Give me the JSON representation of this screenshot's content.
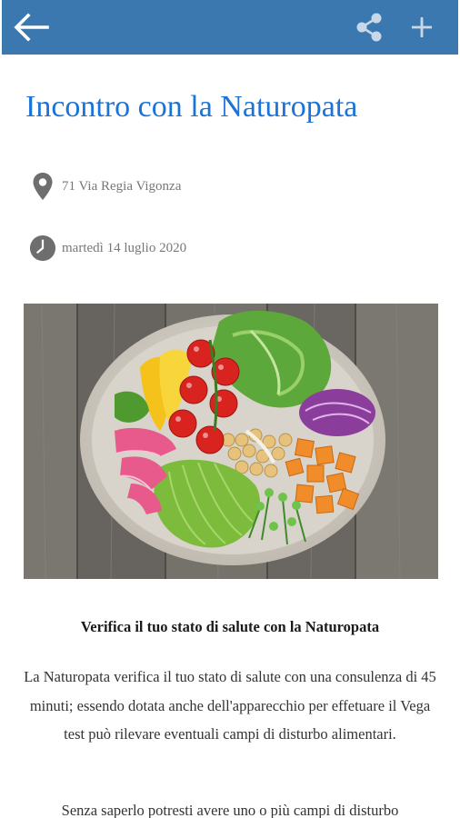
{
  "appbar": {
    "background": "#3c78b0",
    "back_icon": "arrow-left-icon",
    "share_icon": "share-icon",
    "add_icon": "plus-icon"
  },
  "event": {
    "title": "Incontro con la Naturopata",
    "location": "71 Via Regia Vigonza",
    "date": "martedì 14 luglio 2020",
    "title_color": "#1a73d9"
  },
  "content": {
    "subheading": "Verifica il tuo stato di salute con la Naturopata",
    "paragraph_1": "La Naturopata verifica il tuo stato di salute con una consulenza di 45 minuti; essendo dotata anche dell'apparecchio per effetuare il Vega test può rilevare eventuali campi di disturbo alimentari.",
    "paragraph_2": "Senza saperlo potresti avere uno o più campi di disturbo"
  }
}
